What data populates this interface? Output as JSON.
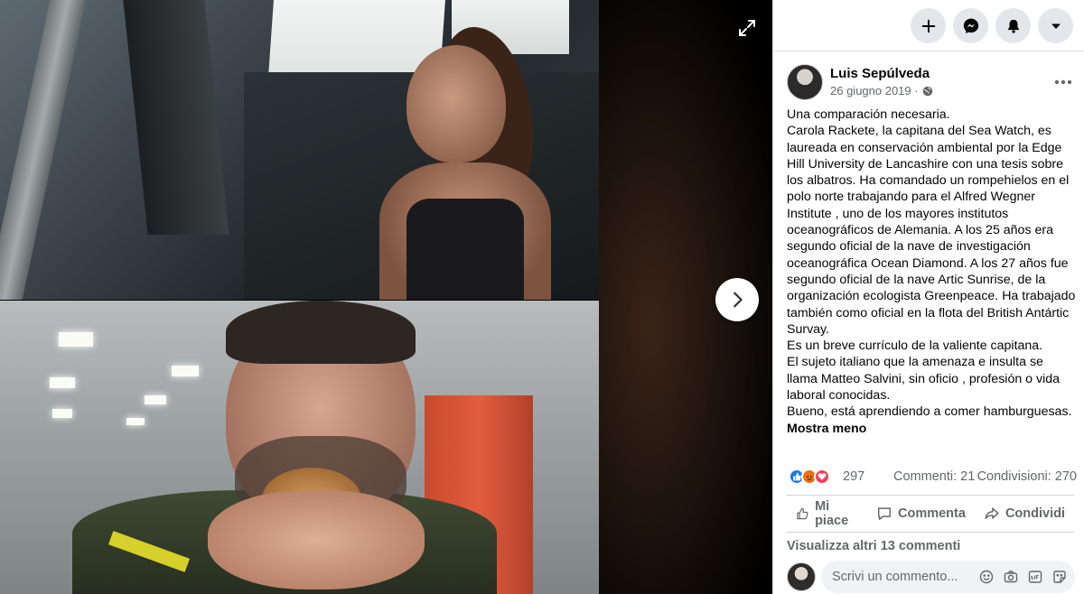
{
  "viewer": {
    "expand_icon": "expand-icon",
    "next_icon": "chevron-right-icon"
  },
  "toolbar": {
    "icons": [
      "plus-icon",
      "messenger-icon",
      "bell-icon",
      "caret-down-icon"
    ]
  },
  "post": {
    "author": "Luis Sepúlveda",
    "date": "26 giugno 2019 ·",
    "privacy_icon": "globe-icon",
    "text_lines": [
      "Una comparación necesaria.",
      "Carola Rackete, la capitana del Sea Watch, es laureada en conservación ambiental por la Edge Hill University de Lancashire con una tesis sobre los albatros. Ha comandado un rompehielos en el polo norte trabajando para el Alfred Wegner Institute , uno de los mayores institutos oceanográficos de Alemania. A los 25 años era segundo oficial de la nave de investigación oceanográfica Ocean Diamond. A los 27 años fue segundo oficial de la nave Artic Sunrise, de la organización ecologista Greenpeace. Ha trabajado también como oficial en la flota del British Antártic Survay.",
      "Es un breve currículo de la valiente capitana.",
      "El sujeto italiano que la amenaza e insulta se llama Matteo Salvini, sin oficio , profesión o vida laboral conocidas.",
      "Bueno, está aprendiendo a comer hamburguesas."
    ],
    "show_less": "Mostra meno"
  },
  "stats": {
    "reactions_count": "297",
    "comments": "Commenti: 21",
    "shares": "Condivisioni: 270",
    "reaction_types": [
      "like",
      "angry",
      "love"
    ]
  },
  "actions": {
    "like": "Mi piace",
    "comment": "Commenta",
    "share": "Condividi"
  },
  "comments": {
    "view_more": "Visualizza altri 13 commenti",
    "placeholder": "Scrivi un commento...",
    "tool_icons": [
      "emoji-icon",
      "camera-icon",
      "gif-icon",
      "sticker-icon"
    ]
  },
  "colors": {
    "accent": "#1877f2",
    "secondary_text": "#65676b",
    "button_bg": "#e4e6eb"
  }
}
